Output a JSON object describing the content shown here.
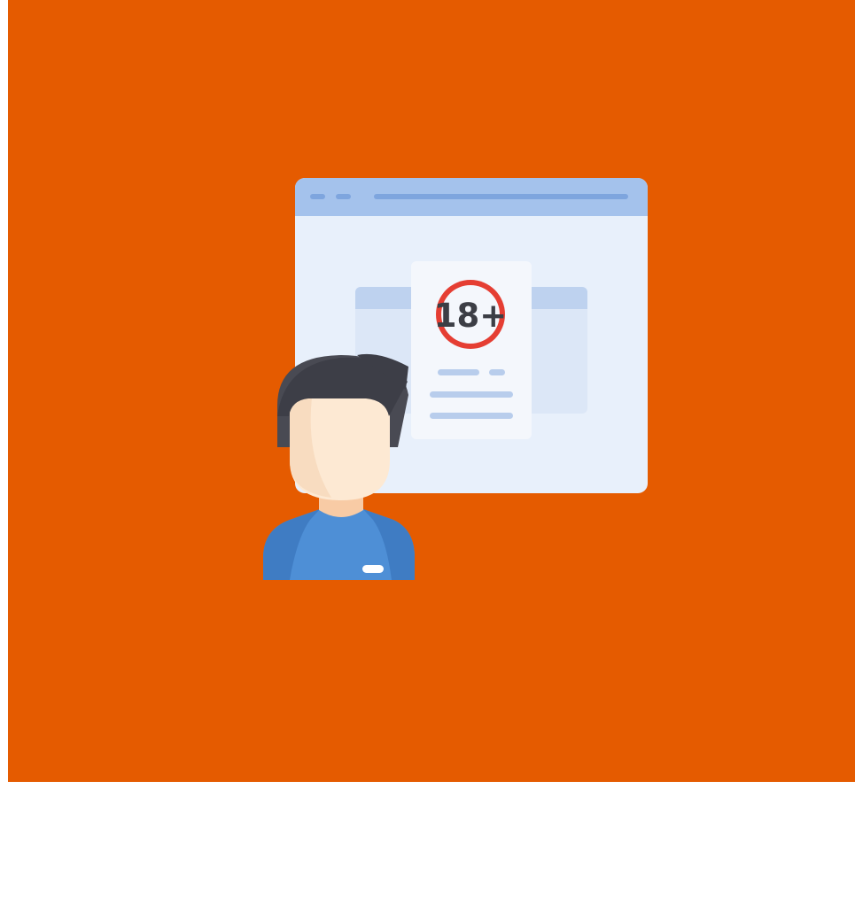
{
  "illustration": {
    "badge_text": "18+",
    "icons": {
      "window": "browser-window-icon",
      "card": "age-restriction-card-icon",
      "badge": "age-18-plus-badge-icon",
      "person": "user-avatar-icon"
    }
  },
  "colors": {
    "background": "#e55b00",
    "window_bar": "#a4c2ec",
    "window_body": "#e8f0fb",
    "badge_ring": "#e53e33",
    "badge_text": "#3c3e45",
    "hair": "#494a53",
    "skin": "#fde9d3",
    "shirt": "#4e8fd6"
  }
}
